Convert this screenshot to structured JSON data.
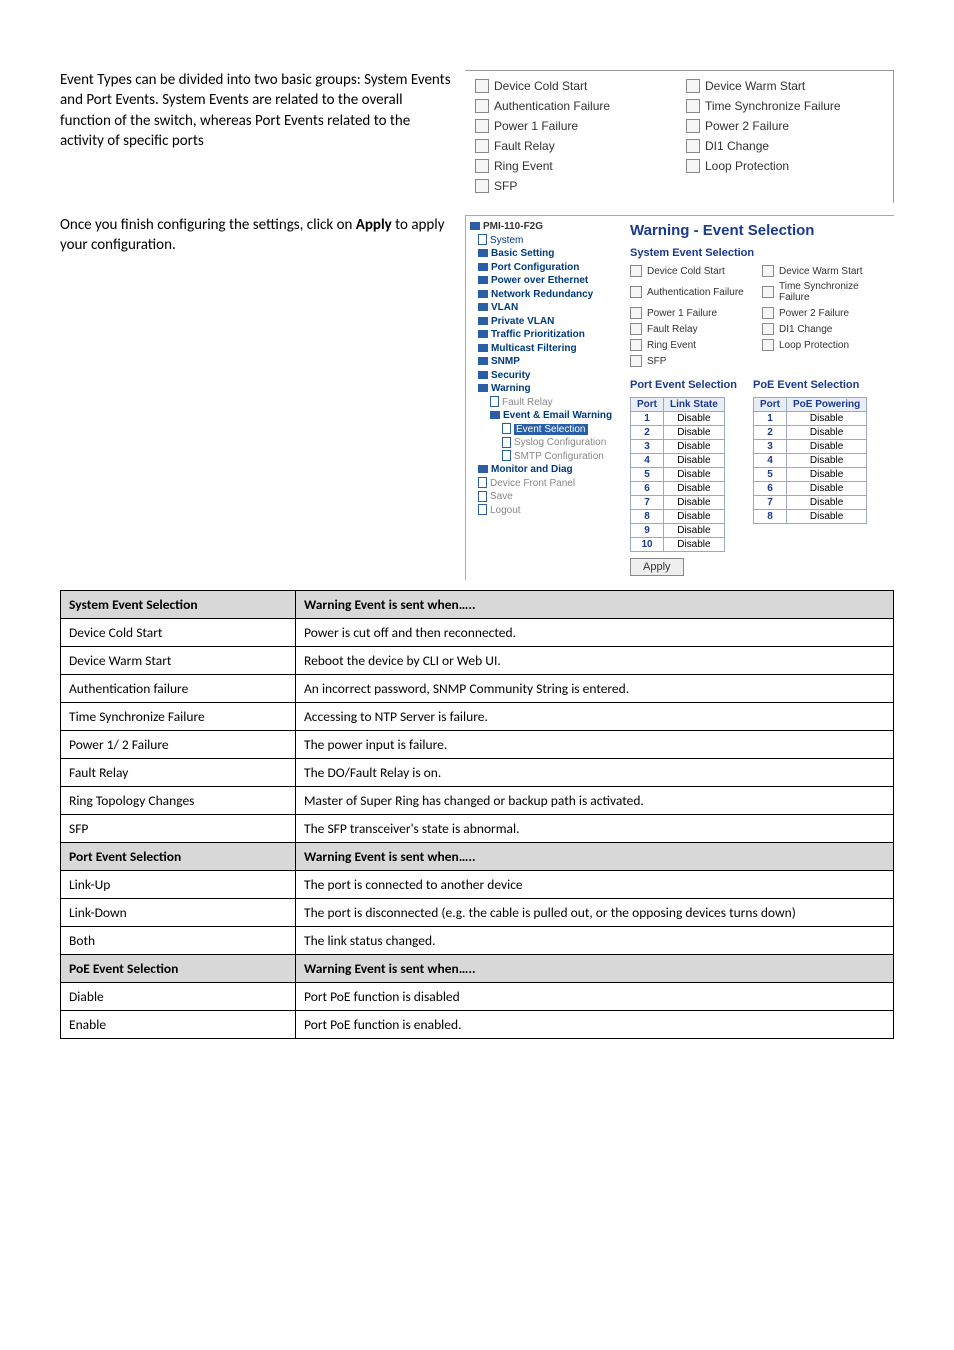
{
  "intro": {
    "line": "Event Types can be divided into two basic groups: System Events and Port Events. System Events are related to the overall function of the switch, whereas Port Events related to the activity of specific ports"
  },
  "apply_text": {
    "pre": "Once you finish configuring the settings, click on ",
    "bold": "Apply",
    "post": " to apply your configuration."
  },
  "sys_box": {
    "items": [
      "Device Cold Start",
      "Device Warm Start",
      "Authentication Failure",
      "Time Synchronize Failure",
      "Power 1 Failure",
      "Power 2 Failure",
      "Fault Relay",
      "DI1 Change",
      "Ring Event",
      "Loop Protection",
      "SFP"
    ]
  },
  "tree": {
    "root": "PMI-110-F2G",
    "items": [
      {
        "lvl": 1,
        "label": "System",
        "ic": "doc"
      },
      {
        "lvl": 1,
        "label": "Basic Setting",
        "ic": "folder",
        "bold": true
      },
      {
        "lvl": 1,
        "label": "Port Configuration",
        "ic": "folder",
        "bold": true
      },
      {
        "lvl": 1,
        "label": "Power over Ethernet",
        "ic": "folder",
        "bold": true
      },
      {
        "lvl": 1,
        "label": "Network Redundancy",
        "ic": "folder",
        "bold": true
      },
      {
        "lvl": 1,
        "label": "VLAN",
        "ic": "folder",
        "bold": true
      },
      {
        "lvl": 1,
        "label": "Private VLAN",
        "ic": "folder",
        "bold": true
      },
      {
        "lvl": 1,
        "label": "Traffic Prioritization",
        "ic": "folder",
        "bold": true
      },
      {
        "lvl": 1,
        "label": "Multicast Filtering",
        "ic": "folder",
        "bold": true
      },
      {
        "lvl": 1,
        "label": "SNMP",
        "ic": "folder",
        "bold": true
      },
      {
        "lvl": 1,
        "label": "Security",
        "ic": "folder",
        "bold": true
      },
      {
        "lvl": 1,
        "label": "Warning",
        "ic": "folder-open",
        "bold": true
      },
      {
        "lvl": 2,
        "label": "Fault Relay",
        "ic": "doc",
        "grey": true
      },
      {
        "lvl": 2,
        "label": "Event & Email Warning",
        "ic": "folder-open",
        "bold": true
      },
      {
        "lvl": 3,
        "label": "Event Selection",
        "ic": "doc",
        "sel": true
      },
      {
        "lvl": 3,
        "label": "Syslog Configuration",
        "ic": "doc",
        "grey": true
      },
      {
        "lvl": 3,
        "label": "SMTP Configuration",
        "ic": "doc",
        "grey": true
      },
      {
        "lvl": 1,
        "label": "Monitor and Diag",
        "ic": "folder",
        "bold": true
      },
      {
        "lvl": 1,
        "label": "Device Front Panel",
        "ic": "doc",
        "grey": true
      },
      {
        "lvl": 1,
        "label": "Save",
        "ic": "doc",
        "grey": true
      },
      {
        "lvl": 1,
        "label": "Logout",
        "ic": "doc",
        "grey": true
      }
    ]
  },
  "right": {
    "title": "Warning - Event Selection",
    "sys_title": "System Event Selection",
    "sys_items": [
      "Device Cold Start",
      "Device Warm Start",
      "Authentication Failure",
      "Time Synchronize Failure",
      "Power 1 Failure",
      "Power 2 Failure",
      "Fault Relay",
      "DI1 Change",
      "Ring Event",
      "Loop Protection",
      "SFP"
    ],
    "port_title": "Port Event Selection",
    "poe_title": "PoE Event Selection",
    "port_headers": [
      "Port",
      "Link State"
    ],
    "poe_headers": [
      "Port",
      "PoE Powering"
    ],
    "port_rows": [
      {
        "p": "1",
        "v": "Disable"
      },
      {
        "p": "2",
        "v": "Disable"
      },
      {
        "p": "3",
        "v": "Disable"
      },
      {
        "p": "4",
        "v": "Disable"
      },
      {
        "p": "5",
        "v": "Disable"
      },
      {
        "p": "6",
        "v": "Disable"
      },
      {
        "p": "7",
        "v": "Disable"
      },
      {
        "p": "8",
        "v": "Disable"
      },
      {
        "p": "9",
        "v": "Disable"
      },
      {
        "p": "10",
        "v": "Disable"
      }
    ],
    "poe_rows": [
      {
        "p": "1",
        "v": "Disable"
      },
      {
        "p": "2",
        "v": "Disable"
      },
      {
        "p": "3",
        "v": "Disable"
      },
      {
        "p": "4",
        "v": "Disable"
      },
      {
        "p": "5",
        "v": "Disable"
      },
      {
        "p": "6",
        "v": "Disable"
      },
      {
        "p": "7",
        "v": "Disable"
      },
      {
        "p": "8",
        "v": "Disable"
      }
    ],
    "apply": "Apply"
  },
  "table": {
    "sections": [
      {
        "header": [
          "System Event Selection",
          "Warning Event is sent when….."
        ],
        "rows": [
          [
            "Device Cold Start",
            "Power is cut off and then reconnected."
          ],
          [
            "Device Warm Start",
            "Reboot the device by CLI or Web UI."
          ],
          [
            "Authentication failure",
            "An incorrect password, SNMP Community String is entered."
          ],
          [
            "Time Synchronize Failure",
            "Accessing to NTP Server is failure."
          ],
          [
            "Power 1/ 2 Failure",
            "The power input is failure."
          ],
          [
            "Fault Relay",
            "The DO/Fault Relay is on."
          ],
          [
            "Ring Topology Changes",
            "Master of Super Ring has changed or backup path is activated."
          ],
          [
            "SFP",
            "The SFP transceiver's state is abnormal."
          ]
        ]
      },
      {
        "header": [
          "Port Event Selection",
          "Warning Event is sent when….."
        ],
        "rows": [
          [
            "Link-Up",
            "The port is connected to another device"
          ],
          [
            "Link-Down",
            "The port is disconnected (e.g. the cable is pulled out, or the opposing devices turns down)"
          ],
          [
            "Both",
            "The link status changed."
          ]
        ]
      },
      {
        "header": [
          "PoE Event Selection",
          "Warning Event is sent when….."
        ],
        "rows": [
          [
            "Diable",
            "Port PoE function is disabled"
          ],
          [
            "Enable",
            "Port PoE function is enabled."
          ]
        ]
      }
    ]
  }
}
